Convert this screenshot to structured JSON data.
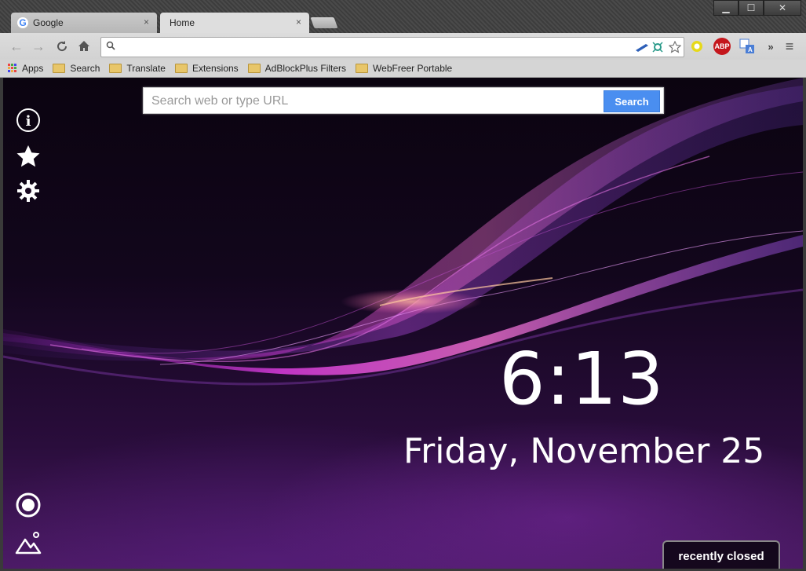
{
  "tabs": [
    {
      "title": "Google",
      "icon": "google-favicon",
      "close": "×"
    },
    {
      "title": "Home",
      "close": "×"
    }
  ],
  "window_controls": {
    "minimize": "▁",
    "maximize": "☐",
    "close": "✕"
  },
  "toolbar": {
    "back": "←",
    "forward": "→",
    "reload": "C",
    "home": "⌂",
    "omnibox_value": "",
    "overflow": "»",
    "menu": "≡",
    "extensions": {
      "abp": "ABP"
    }
  },
  "bookmarks": [
    {
      "label": "Apps",
      "icon": "apps-grid-icon"
    },
    {
      "label": "Search",
      "icon": "folder-icon"
    },
    {
      "label": "Translate",
      "icon": "folder-icon"
    },
    {
      "label": "Extensions",
      "icon": "folder-icon"
    },
    {
      "label": "AdBlockPlus Filters",
      "icon": "folder-icon"
    },
    {
      "label": "WebFreer Portable",
      "icon": "folder-icon"
    }
  ],
  "newtab": {
    "search_placeholder": "Search web or type URL",
    "search_button": "Search",
    "time": "6:13",
    "date": "Friday, November 25",
    "recently_closed": "recently closed"
  },
  "colors": {
    "accent": "#4a8ef0",
    "background": "#2a0d3c",
    "wave": "#c03ad8"
  }
}
